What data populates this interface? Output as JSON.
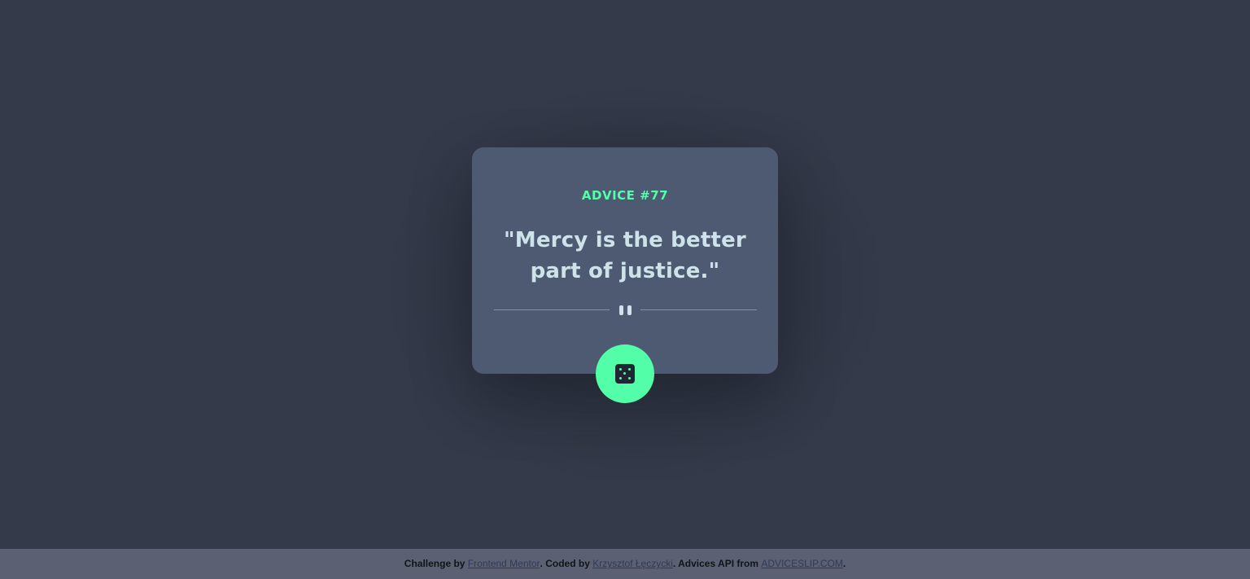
{
  "advice": {
    "id_label": "ADVICE #77",
    "text": "\"Mercy is the better part of justice.\""
  },
  "dice_button": {
    "icon": "dice-icon",
    "accent": "#52ffa8"
  },
  "divider": {
    "icon": "pause-icon"
  },
  "footer": {
    "challenge_prefix": "Challenge by ",
    "challenge_link": "Frontend Mentor",
    "coded_prefix": ". Coded by ",
    "author_link": "Krzysztof Łęczycki",
    "api_prefix": ". Advices API from ",
    "api_link": "ADVICESLIP.COM",
    "suffix": "."
  },
  "colors": {
    "background": "#343a4a",
    "card": "#4e5a72",
    "accent": "#52ffa8",
    "quote_text": "#cee3e9",
    "footer_bg": "#5b6172"
  }
}
